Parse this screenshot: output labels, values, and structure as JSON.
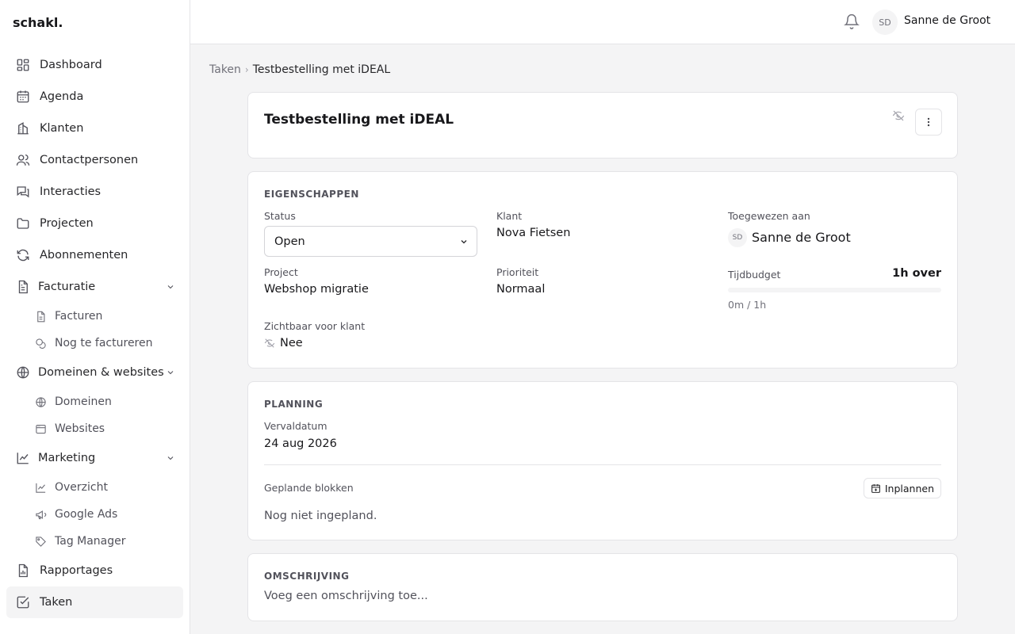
{
  "app": {
    "brand": "schakl."
  },
  "sidebar": {
    "items": [
      {
        "label": "Dashboard",
        "icon": "layout-dashboard-icon"
      },
      {
        "label": "Agenda",
        "icon": "calendar-icon"
      },
      {
        "label": "Klanten",
        "icon": "building-icon"
      },
      {
        "label": "Contactpersonen",
        "icon": "users-icon"
      },
      {
        "label": "Interacties",
        "icon": "messages-icon"
      },
      {
        "label": "Projecten",
        "icon": "folder-icon"
      },
      {
        "label": "Abonnementen",
        "icon": "refresh-icon"
      }
    ],
    "facturatie": {
      "label": "Facturatie",
      "icon": "file-text-icon",
      "children": [
        {
          "label": "Facturen",
          "icon": "file-icon"
        },
        {
          "label": "Nog te factureren",
          "icon": "coins-icon"
        }
      ]
    },
    "domeinen": {
      "label": "Domeinen & websites",
      "icon": "globe-icon",
      "children": [
        {
          "label": "Domeinen",
          "icon": "globe-icon"
        },
        {
          "label": "Websites",
          "icon": "browser-icon"
        }
      ]
    },
    "marketing": {
      "label": "Marketing",
      "icon": "chart-line-icon",
      "children": [
        {
          "label": "Overzicht",
          "icon": "chart-line-icon"
        },
        {
          "label": "Google Ads",
          "icon": "megaphone-icon"
        },
        {
          "label": "Tag Manager",
          "icon": "tag-icon"
        }
      ]
    },
    "rapportages": {
      "label": "Rapportages",
      "icon": "file-chart-icon"
    },
    "taken": {
      "label": "Taken",
      "icon": "check-square-icon",
      "active": true
    }
  },
  "topbar": {
    "avatar_initials": "SD",
    "user_name": "Sanne de Groot"
  },
  "breadcrumb": {
    "parent": "Taken",
    "separator": "›",
    "current": "Testbestelling met iDEAL"
  },
  "task": {
    "title": "Testbestelling met iDEAL"
  },
  "eigenschappen": {
    "section_title": "EIGENSCHAPPEN",
    "status_label": "Status",
    "status_value": "Open",
    "klant_label": "Klant",
    "klant_value": "Nova Fietsen",
    "toegewezen_label": "Toegewezen aan",
    "toegewezen_initials": "SD",
    "toegewezen_value": "Sanne de Groot",
    "project_label": "Project",
    "project_value": "Webshop migratie",
    "prioriteit_label": "Prioriteit",
    "prioriteit_value": "Normaal",
    "tijdbudget_label": "Tijdbudget",
    "tijdbudget_remaining": "1h over",
    "tijdbudget_usage": "0m / 1h",
    "tijdbudget_used_fraction": 0,
    "zichtbaar_label": "Zichtbaar voor klant",
    "zichtbaar_value": "Nee"
  },
  "planning": {
    "section_title": "PLANNING",
    "vervaldatum_label": "Vervaldatum",
    "vervaldatum_value": "24 aug 2026",
    "blokken_label": "Geplande blokken",
    "inplannen_button": "Inplannen",
    "empty_text": "Nog niet ingepland."
  },
  "omschrijving": {
    "section_title": "OMSCHRIJVING",
    "placeholder": "Voeg een omschrijving toe..."
  },
  "colors": {
    "accent": "#18181b",
    "border": "#e4e4e7",
    "muted_text": "#71717a",
    "background": "#f4f4f5"
  }
}
